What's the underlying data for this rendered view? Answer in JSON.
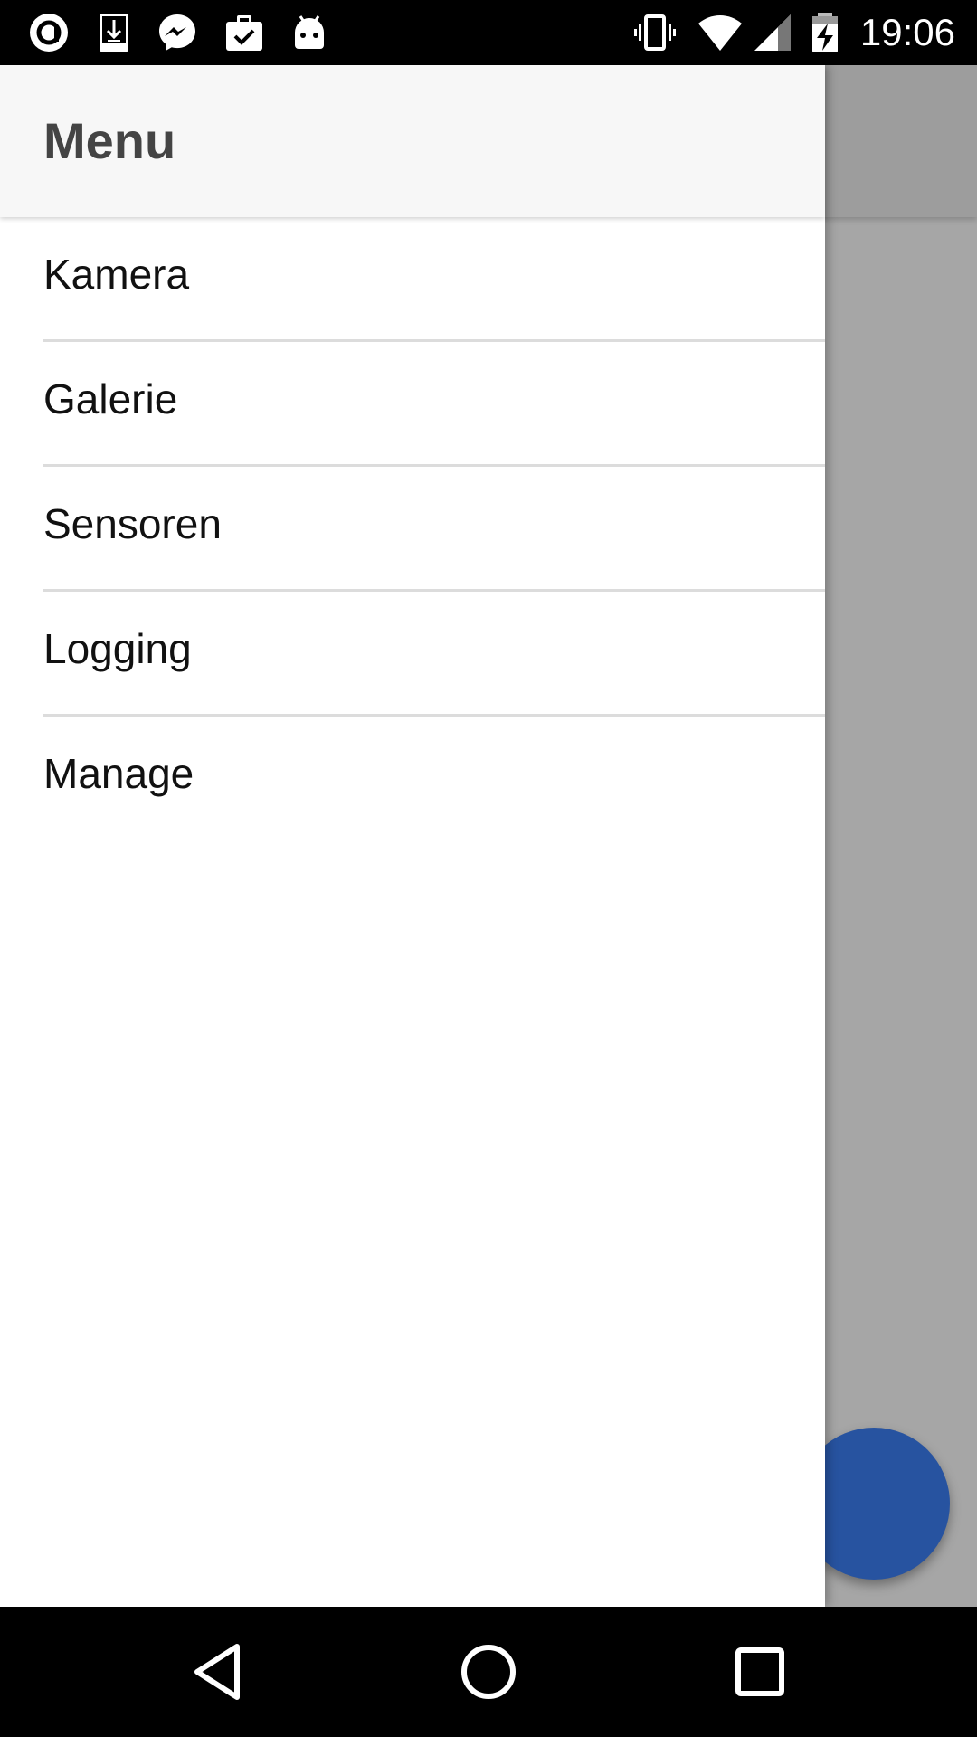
{
  "status_bar": {
    "time": "19:06",
    "left_icons": [
      "app-circle-a-icon",
      "download-icon",
      "messenger-icon",
      "clipboard-check-icon",
      "android-icon"
    ],
    "right_icons": [
      "vibrate-icon",
      "wifi-icon",
      "cell-signal-icon",
      "battery-charging-icon"
    ]
  },
  "drawer": {
    "title": "Menu",
    "items": [
      {
        "label": "Kamera"
      },
      {
        "label": "Galerie"
      },
      {
        "label": "Sensoren"
      },
      {
        "label": "Logging"
      },
      {
        "label": "Manage"
      }
    ]
  },
  "fab": {
    "color": "#2753a0"
  },
  "nav_bar": {
    "buttons": [
      "back-icon",
      "home-icon",
      "recents-icon"
    ]
  },
  "colors": {
    "scrim": "#a6a6a6",
    "drawer_header_bg": "#f7f7f7",
    "divider": "#dcdcdc"
  }
}
